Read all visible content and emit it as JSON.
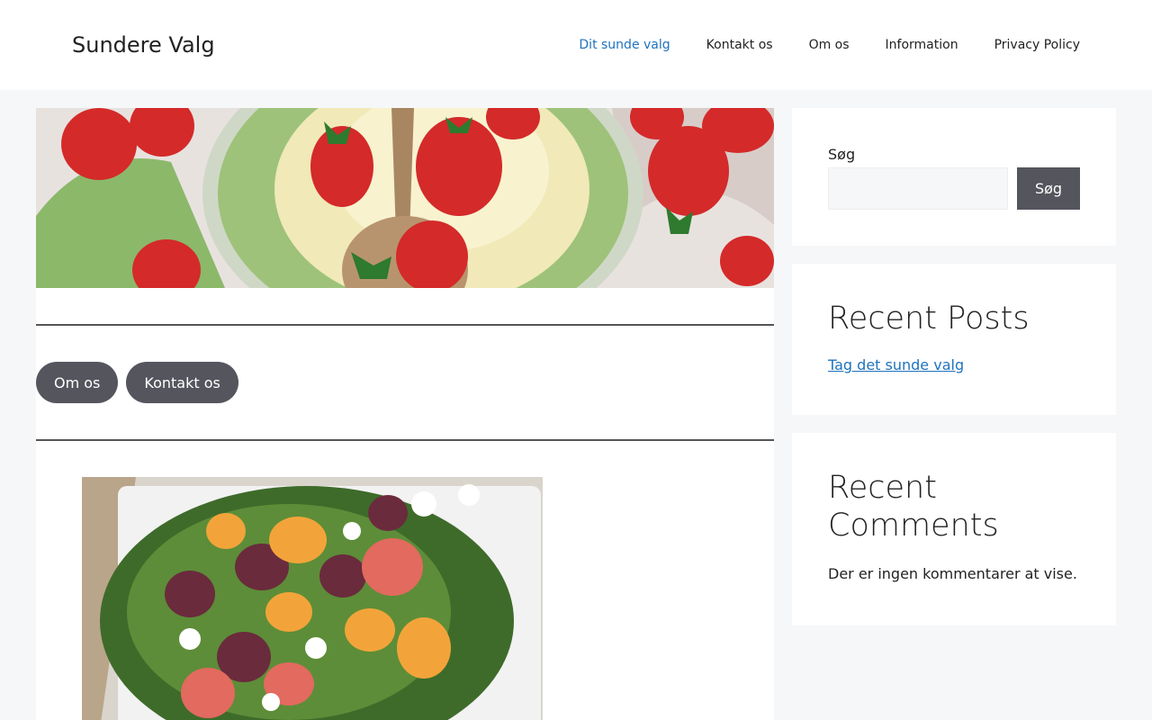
{
  "site": {
    "title": "Sundere Valg"
  },
  "nav": {
    "items": [
      {
        "label": "Dit sunde valg",
        "active": true
      },
      {
        "label": "Kontakt os",
        "active": false
      },
      {
        "label": "Om os",
        "active": false
      },
      {
        "label": "Information",
        "active": false
      },
      {
        "label": "Privacy Policy",
        "active": false
      }
    ]
  },
  "content": {
    "buttons": [
      "Om os",
      "Kontakt os"
    ]
  },
  "sidebar": {
    "search": {
      "label": "Søg",
      "placeholder": "",
      "value": "",
      "button": "Søg"
    },
    "recent_posts": {
      "title": "Recent Posts",
      "items": [
        "Tag det sunde valg"
      ]
    },
    "recent_comments": {
      "title": "Recent Comments",
      "empty_text": "Der er ingen kommentarer at vise."
    }
  },
  "colors": {
    "accent_link": "#1e73be",
    "button_bg": "#55555e",
    "page_bg": "#f6f7f9"
  }
}
